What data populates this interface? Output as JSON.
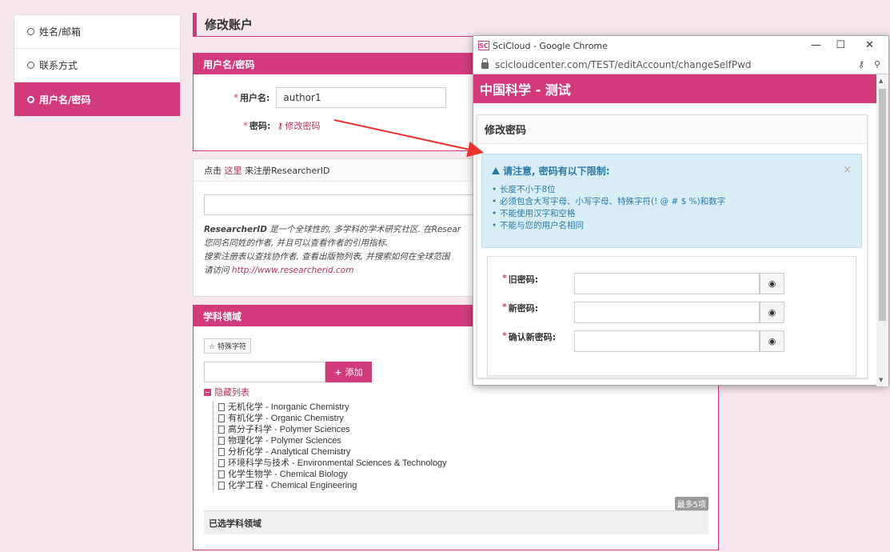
{
  "sidebar": {
    "items": [
      {
        "label": "姓名/邮箱"
      },
      {
        "label": "联系方式"
      },
      {
        "label": "用户名/密码"
      }
    ]
  },
  "page": {
    "title": "修改账户"
  },
  "account_panel": {
    "header": "用户名/密码",
    "username_label": "用户名:",
    "username_value": "author1",
    "password_label": "密码:",
    "change_password_link": "修改密码"
  },
  "researcher_panel": {
    "register_prefix": "点击",
    "register_link": "这里",
    "register_suffix": "来注册ResearcherID",
    "desc_bold": "ResearcherID",
    "desc_line1": "是一个全球性的, 多学科的学术研究社区. 在Resear",
    "desc_line2": "您同名同姓的作者, 并且可以查看作者的引用指标.",
    "desc_line3": "搜索注册表以查找协作者, 查看出版物列表, 并搜索如何在全球范围",
    "desc_line4_prefix": "请访问",
    "desc_url": "http://www.researcherid.com"
  },
  "subject_panel": {
    "header": "学科领域",
    "special_chars_btn": "特殊字符",
    "add_btn": "添加",
    "hide_list": "隐藏列表",
    "items": [
      "无机化学 - Inorganic Chemistry",
      "有机化学 - Organic Chemistry",
      "高分子科学 - Polymer Sciences",
      "物理化学 - Polymer Sciences",
      "分析化学 - Analytical Chemistry",
      "环境科学与技术 - Environmental Sciences & Technology",
      "化学生物学 - Chemical Biology",
      "化学工程 - Chemical Engineering"
    ],
    "max_badge": "最多5项",
    "selected_label": "已选学科领域"
  },
  "popup": {
    "window_title": "SciCloud - Google Chrome",
    "logo": "SC",
    "url": "scicloudcenter.com/TEST/editAccount/changeSelfPwd",
    "site_header": "中国科学 - 测试",
    "modal_title": "修改密码",
    "notice_title": "请注意, 密码有以下限制:",
    "rules": [
      "长度不小于8位",
      "必须包含大写字母、小写字母、特殊字符(! @ # $ %)和数字",
      "不能使用汉字和空格",
      "不能与您的用户名相同"
    ],
    "old_pwd_label": "旧密码:",
    "new_pwd_label": "新密码:",
    "confirm_pwd_label": "确认新密码:"
  },
  "colors": {
    "accent": "#d13b7c",
    "info": "#2a7aa8",
    "info_bg": "#d9eef4"
  }
}
